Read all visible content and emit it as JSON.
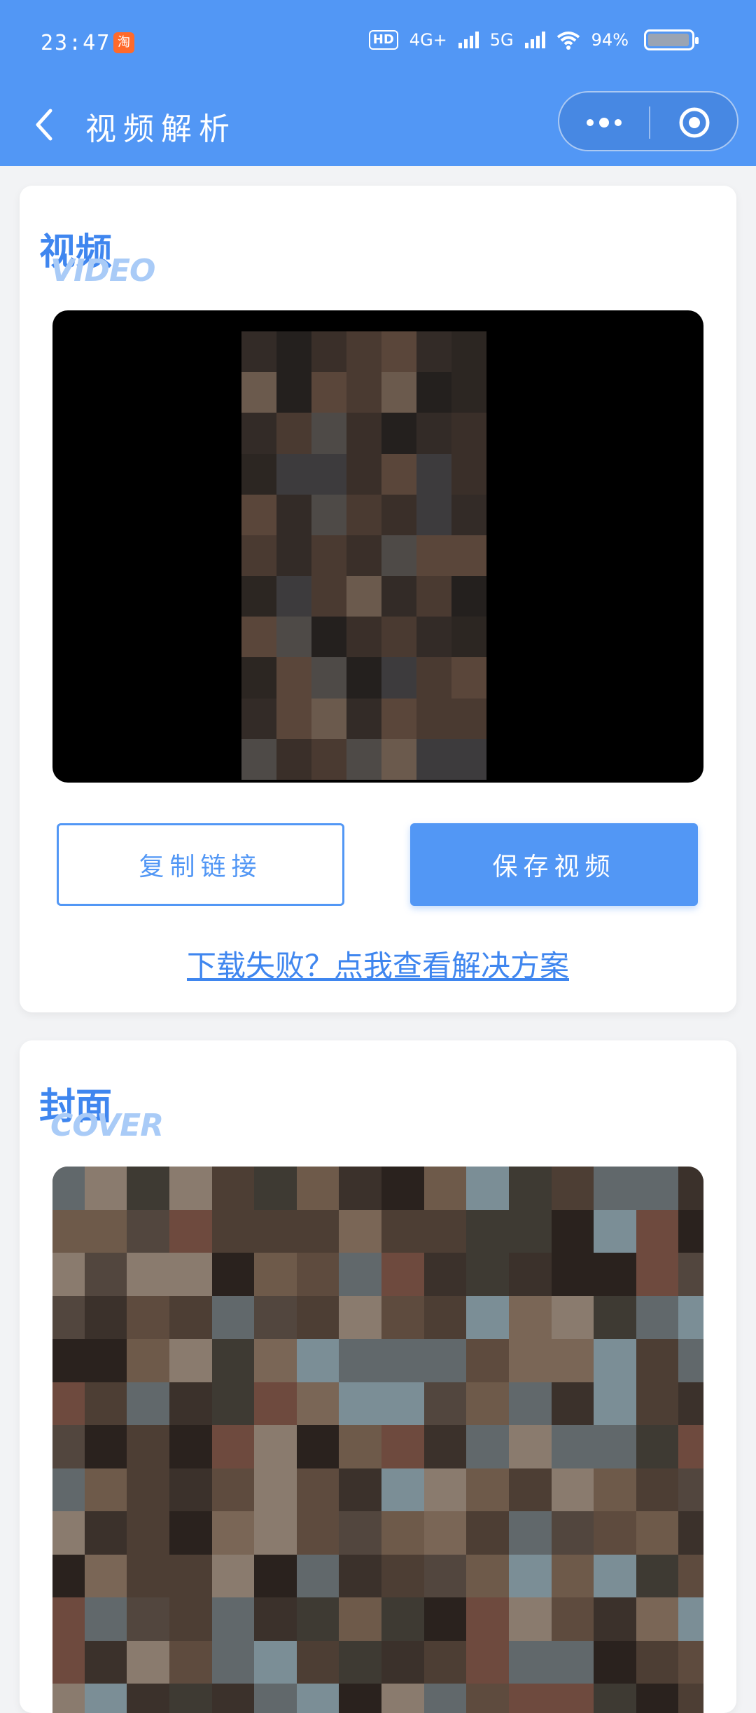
{
  "status_bar": {
    "time": "23:47",
    "hd_label": "HD",
    "network1": "4G+",
    "network2": "5G",
    "battery": "94%"
  },
  "nav": {
    "title": "视频解析"
  },
  "video_section": {
    "title": "视频",
    "subtitle": "VIDEO",
    "copy_button": "复制链接",
    "save_button": "保存视频",
    "help_link": "下载失败？点我查看解决方案"
  },
  "cover_section": {
    "title": "封面",
    "subtitle": "COVER"
  },
  "colors": {
    "primary": "#5297f5",
    "title_blue": "#3f86ef",
    "subtitle_blue": "#a9cbf7"
  }
}
